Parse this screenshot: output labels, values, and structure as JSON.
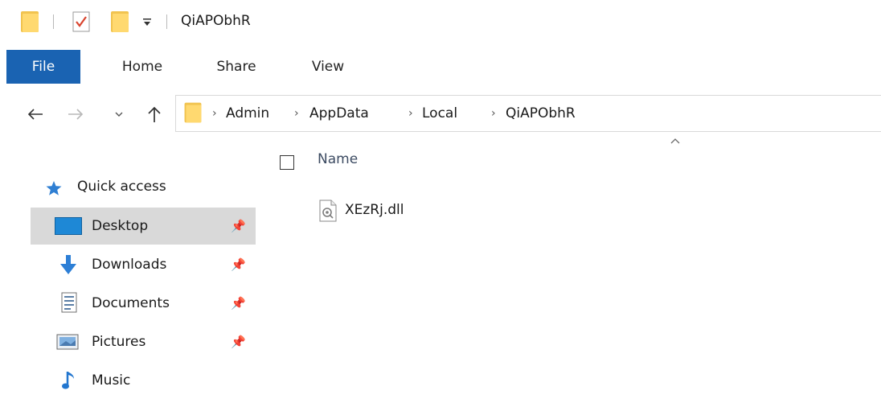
{
  "window": {
    "title": "QiAPObhR",
    "quick_toolbar": [
      "folder-icon",
      "properties-icon",
      "new-folder-icon",
      "customize-dropdown-icon"
    ]
  },
  "ribbon": {
    "tabs": [
      {
        "label": "File",
        "active": true
      },
      {
        "label": "Home",
        "active": false
      },
      {
        "label": "Share",
        "active": false
      },
      {
        "label": "View",
        "active": false
      }
    ],
    "accent_color": "#1a63b2"
  },
  "navigation": {
    "back_icon": "back-arrow-icon",
    "forward_icon": "forward-arrow-icon",
    "recent_icon": "recent-locations-chevron-icon",
    "up_icon": "up-arrow-icon"
  },
  "address_bar": {
    "breadcrumbs": [
      "Admin",
      "AppData",
      "Local",
      "QiAPObhR"
    ]
  },
  "nav_pane": {
    "quick_access_label": "Quick access",
    "items": [
      {
        "label": "Desktop",
        "icon": "desktop-icon",
        "pinned": true,
        "selected": true
      },
      {
        "label": "Downloads",
        "icon": "downloads-icon",
        "pinned": true,
        "selected": false
      },
      {
        "label": "Documents",
        "icon": "documents-icon",
        "pinned": true,
        "selected": false
      },
      {
        "label": "Pictures",
        "icon": "pictures-icon",
        "pinned": true,
        "selected": false
      },
      {
        "label": "Music",
        "icon": "music-icon",
        "pinned": false,
        "selected": false
      }
    ]
  },
  "file_list": {
    "column_header": "Name",
    "sort": "ascending",
    "files": [
      {
        "name": "XEzRj.dll",
        "icon": "dll-file-icon"
      }
    ]
  }
}
